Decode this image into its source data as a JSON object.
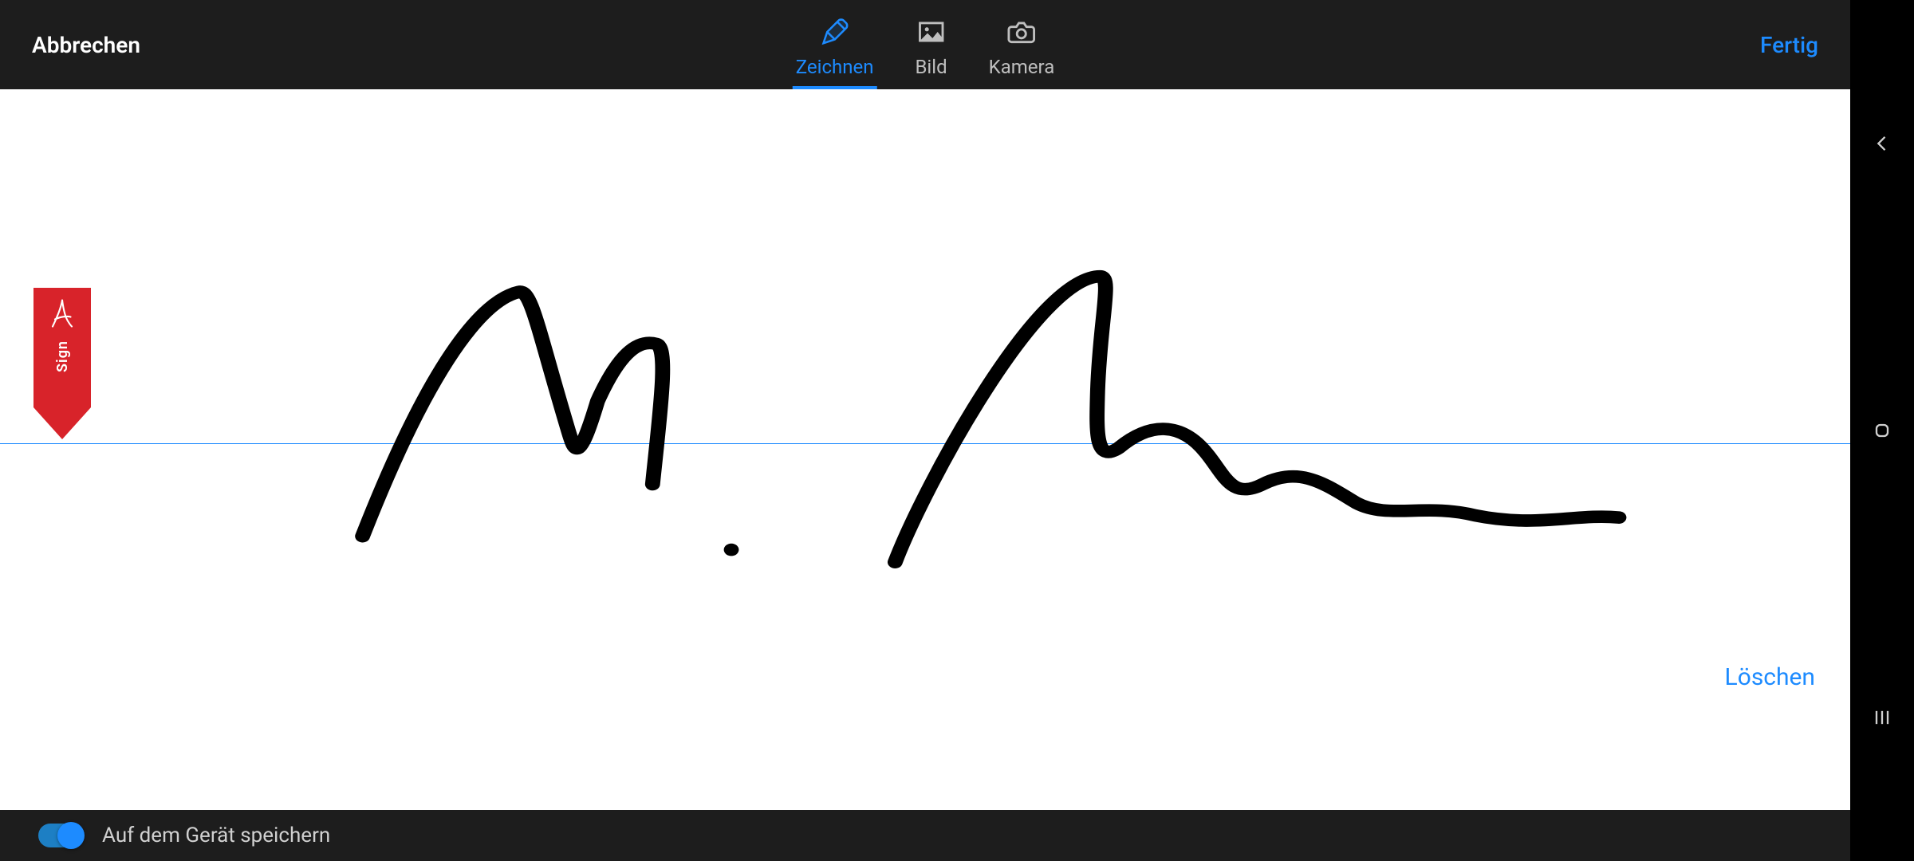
{
  "toolbar": {
    "cancel": "Abbrechen",
    "done": "Fertig",
    "modes": [
      {
        "id": "draw",
        "label": "Zeichnen",
        "active": true
      },
      {
        "id": "image",
        "label": "Bild",
        "active": false
      },
      {
        "id": "camera",
        "label": "Kamera",
        "active": false
      }
    ]
  },
  "canvas": {
    "marker_label": "Sign",
    "delete_label": "Löschen",
    "accent_color": "#1d8bff",
    "marker_color": "#d8232a"
  },
  "footer": {
    "save_toggle_on": true,
    "save_label": "Auf dem Gerät speichern"
  }
}
